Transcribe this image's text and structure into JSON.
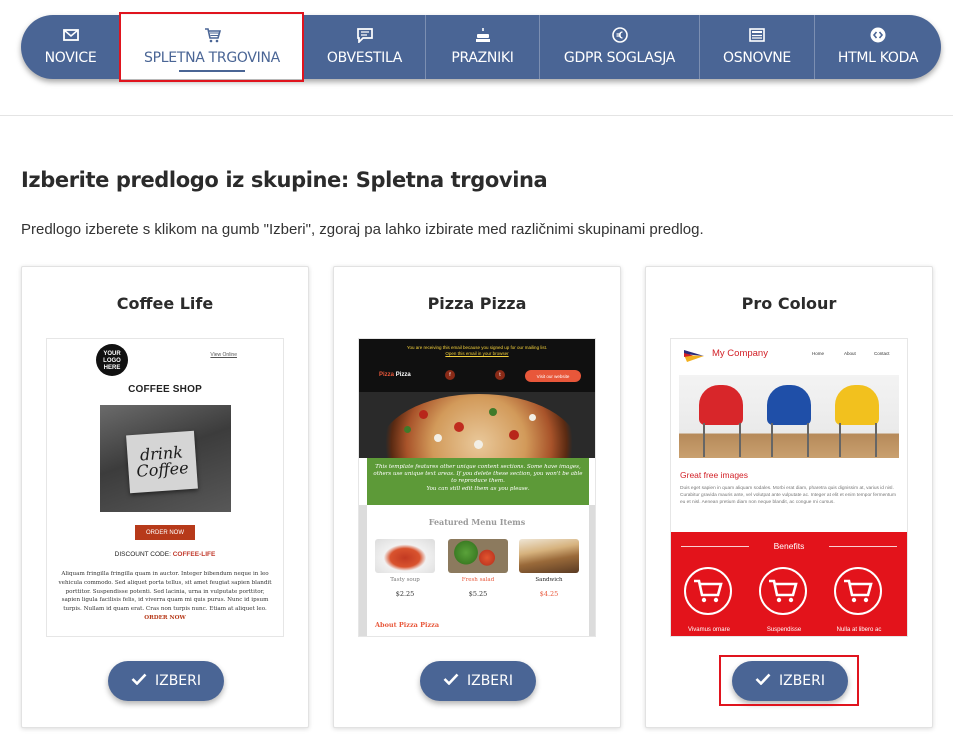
{
  "nav": {
    "items": [
      {
        "label": "NOVICE",
        "icon": "envelope-icon"
      },
      {
        "label": "SPLETNA TRGOVINA",
        "icon": "shopping-cart-icon"
      },
      {
        "label": "OBVESTILA",
        "icon": "message-icon"
      },
      {
        "label": "PRAZNIKI",
        "icon": "cake-icon"
      },
      {
        "label": "GDPR SOGLASJA",
        "icon": "euro-icon"
      },
      {
        "label": "OSNOVNE",
        "icon": "newspaper-icon"
      },
      {
        "label": "HTML KODA",
        "icon": "code-icon"
      }
    ],
    "active_label": "SPLETNA TRGOVINA"
  },
  "heading": "Izberite predlogo iz skupine: Spletna trgovina",
  "description": "Predlogo izberete s klikom na gumb \"Izberi\", zgoraj pa lahko izbirate med različnimi skupinami predlog.",
  "choose_label": "IZBERI",
  "colors": {
    "brand": "#4a6595",
    "highlight": "#e0141e"
  },
  "cards": [
    {
      "title": "Coffee Life",
      "preview": {
        "logo": "YOUR LOGO HERE",
        "view_online": "View Online",
        "shop_title": "COFFEE SHOP",
        "sign_text": "drink Coffee",
        "order_button": "ORDER NOW",
        "discount_label": "DISCOUNT CODE:",
        "discount_code": "COFFEE-LIFE",
        "body_text": "Aliquam fringilla fringilla quam in auctor. Integer bibendum neque in leo vehicula commodo. Sed aliquet porta tellus, sit amet feugiat sapien blandit porttitor. Suspendisse potenti. Sed lacinia, urna in vulputate porttitor, sapien ligula facilisis felis, id viverra quam mi quis purus. Nunc id ipsum turpis. Nullam id quam erat. Cras non turpis nunc. Etiam at aliquet leo.",
        "body_link": "ORDER NOW"
      }
    },
    {
      "title": "Pizza Pizza",
      "preview": {
        "top_note": "You are receiving this email because you signed up for our mailing list.",
        "top_link": "Open this email in your browser",
        "brand_a": "Pizza",
        "brand_b": "Pizza",
        "visit": "Visit our website",
        "green_text": "This template features other unique content sections. Some have images, others use unique text areas. If you delete these section, you won't be able to reproduce them.",
        "green_text2": "You can still edit them as you please.",
        "featured": "Featured Menu Items",
        "items": [
          {
            "name": "Tasty soup",
            "price": "$2.25"
          },
          {
            "name": "Fresh salad",
            "price": "$5.25"
          },
          {
            "name": "Sandwich",
            "price": "$4.25"
          }
        ],
        "about": "About Pizza Pizza"
      }
    },
    {
      "title": "Pro Colour",
      "preview": {
        "company": "My Company",
        "nav": [
          "Home",
          "About",
          "Contact"
        ],
        "headline": "Great free images",
        "body": "Duis eget sapien in quam aliquam sodales. Morbi erat diam, pharetra quis dignissim at, varius id nisl. Curabitur gravida mauris ante, vel volutpat ante vulputate ac. Integer at elit et enim tempor fermentum eu et nisl. Aenean pretium diam non neque blandit, ac congue mi cursus.",
        "benefits": "Benefits",
        "captions": [
          "Vivamus ornare",
          "Suspendisse",
          "Nulla at libero ac"
        ]
      }
    }
  ]
}
